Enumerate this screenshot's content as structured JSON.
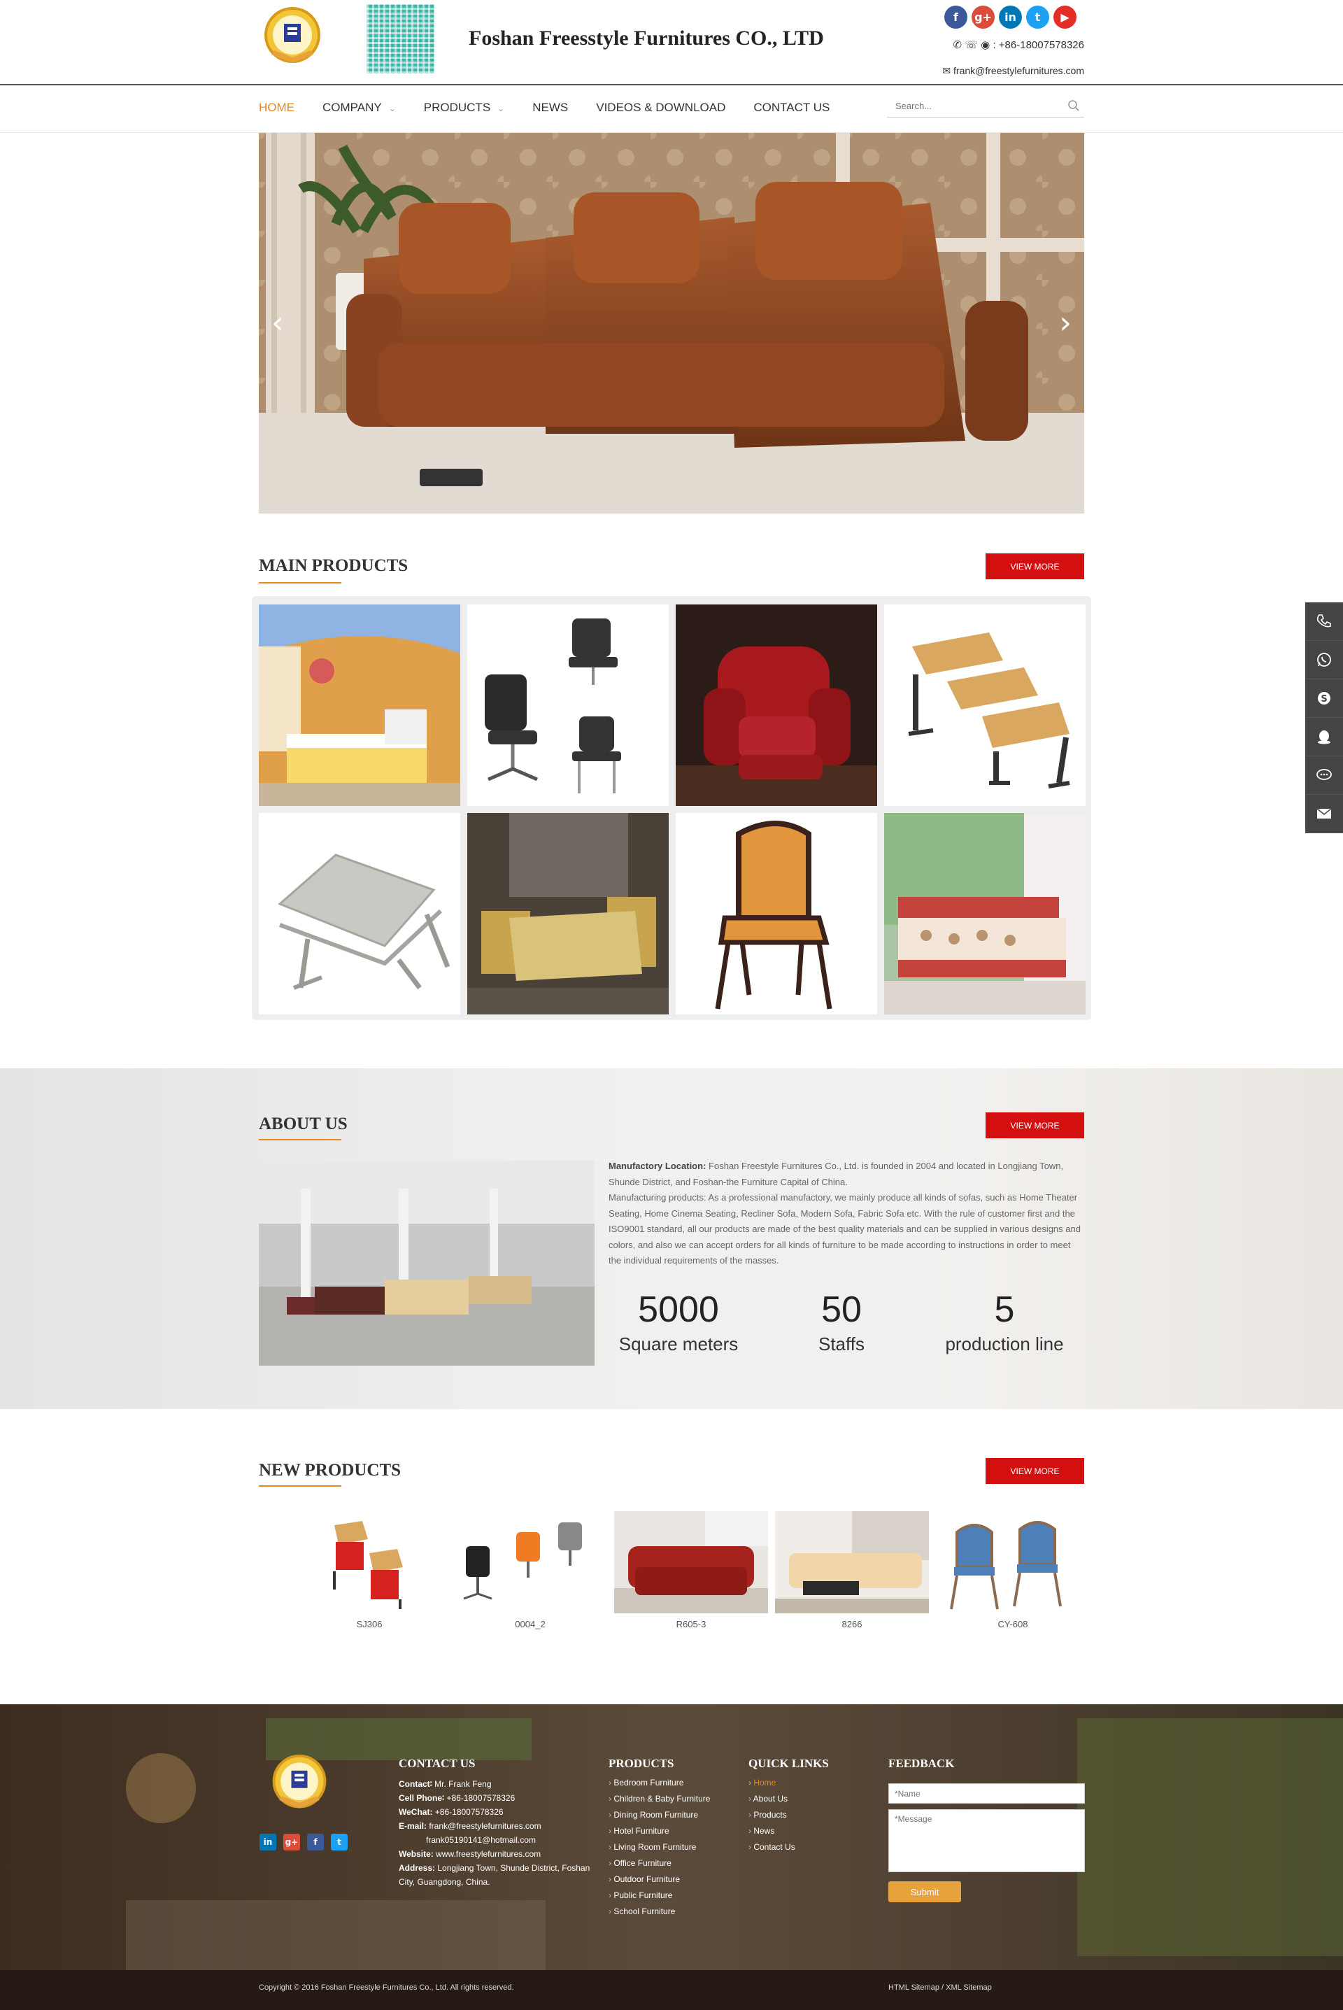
{
  "header": {
    "company_name": "Foshan Freesstyle Furnitures CO., LTD",
    "phone_line": ": +86-18007578326",
    "email": "frank@freestylefurnitures.com",
    "social": [
      {
        "icon": "facebook-icon",
        "glyph": "f",
        "color": "#3b5998"
      },
      {
        "icon": "google-plus-icon",
        "glyph": "g+",
        "color": "#dd4b39"
      },
      {
        "icon": "linkedin-icon",
        "glyph": "in",
        "color": "#0077b5"
      },
      {
        "icon": "twitter-icon",
        "glyph": "t",
        "color": "#1da1f2"
      },
      {
        "icon": "youtube-icon",
        "glyph": "▶",
        "color": "#e52d27"
      }
    ]
  },
  "nav": {
    "items": [
      {
        "label": "HOME",
        "active": true
      },
      {
        "label": "COMPANY",
        "dropdown": true
      },
      {
        "label": "PRODUCTS",
        "dropdown": true
      },
      {
        "label": "NEWS"
      },
      {
        "label": "VIDEOS & DOWNLOAD"
      },
      {
        "label": "CONTACT US"
      }
    ],
    "search_placeholder": "Search..."
  },
  "main_products": {
    "title": "MAIN PRODUCTS",
    "view_more": "VIEW MORE"
  },
  "about": {
    "title": "ABOUT US",
    "view_more": "VIEW MORE",
    "location_label": "Manufactory Location:",
    "location_text": " Foshan Freestyle Furnitures Co., Ltd. is founded in 2004 and located in Longjiang Town, Shunde District, and Foshan-the Furniture Capital of China.",
    "products_text": "Manufacturing products: As a professional manufactory, we mainly produce all kinds of sofas, such as Home Theater Seating, Home Cinema Seating, Recliner Sofa, Modern Sofa, Fabric Sofa etc. With the rule of customer first and the ISO9001 standard, all our products are made of the best quality materials and can be supplied in various designs and colors, and also we can accept orders for all kinds of furniture to be made according to instructions in order to meet the individual requirements of the masses.",
    "stats": [
      {
        "value": "5000",
        "label": "Square meters"
      },
      {
        "value": "50",
        "label": "Staffs"
      },
      {
        "value": "5",
        "label": "production line"
      }
    ]
  },
  "new_products": {
    "title": "NEW PRODUCTS",
    "view_more": "VIEW MORE",
    "items": [
      {
        "caption": "SJ306"
      },
      {
        "caption": "0004_2"
      },
      {
        "caption": "R605-3"
      },
      {
        "caption": "8266"
      },
      {
        "caption": "CY-608"
      }
    ]
  },
  "footer": {
    "contact": {
      "title": "CONTACT US",
      "contact_label": "Contact∶",
      "contact_value": " Mr. Frank Feng",
      "cell_label": "Cell Phone∶",
      "cell_value": " +86-18007578326",
      "wechat_label": "WeChat:",
      "wechat_value": " +86-18007578326",
      "email_label": "E-mail:",
      "email_value": " frank@freestylefurnitures.com",
      "email_value2": "frank05190141@hotmail.com",
      "website_label": "Website:",
      "website_value": " www.freestylefurnitures.com",
      "address_label": "Address:",
      "address_value": " Longjiang Town, Shunde District, Foshan",
      "address_value2": "City, Guangdong, China."
    },
    "products": {
      "title": "PRODUCTS",
      "items": [
        "Bedroom Furniture",
        "Children & Baby Furniture",
        "Dining Room Furniture",
        "Hotel Furniture",
        "Living Room Furniture",
        "Office Furniture",
        "Outdoor Furniture",
        "Public Furniture",
        "School Furniture"
      ]
    },
    "quick_links": {
      "title": "QUICK LINKS",
      "items": [
        "Home",
        "About Us",
        "Products",
        "News",
        "Contact Us"
      ]
    },
    "feedback": {
      "title": "FEEDBACK",
      "name_placeholder": "*Name",
      "message_placeholder": "*Message",
      "submit": "Submit"
    },
    "copyright": "Copyright © 2016 Foshan Freestyle Furnitures Co., Ltd.  All rights reserved.",
    "sitemap": "HTML Sitemap / XML Sitemap",
    "social": [
      {
        "icon": "linkedin-icon",
        "glyph": "in",
        "color": "#0077b5"
      },
      {
        "icon": "google-plus-icon",
        "glyph": "g+",
        "color": "#dd4b39"
      },
      {
        "icon": "facebook-icon",
        "glyph": "f",
        "color": "#3b5998"
      },
      {
        "icon": "twitter-icon",
        "glyph": "t",
        "color": "#1da1f2"
      }
    ]
  },
  "colors": {
    "accent": "#e8881c",
    "button_red": "#d40f0f",
    "submit_orange": "#e8a23c"
  }
}
